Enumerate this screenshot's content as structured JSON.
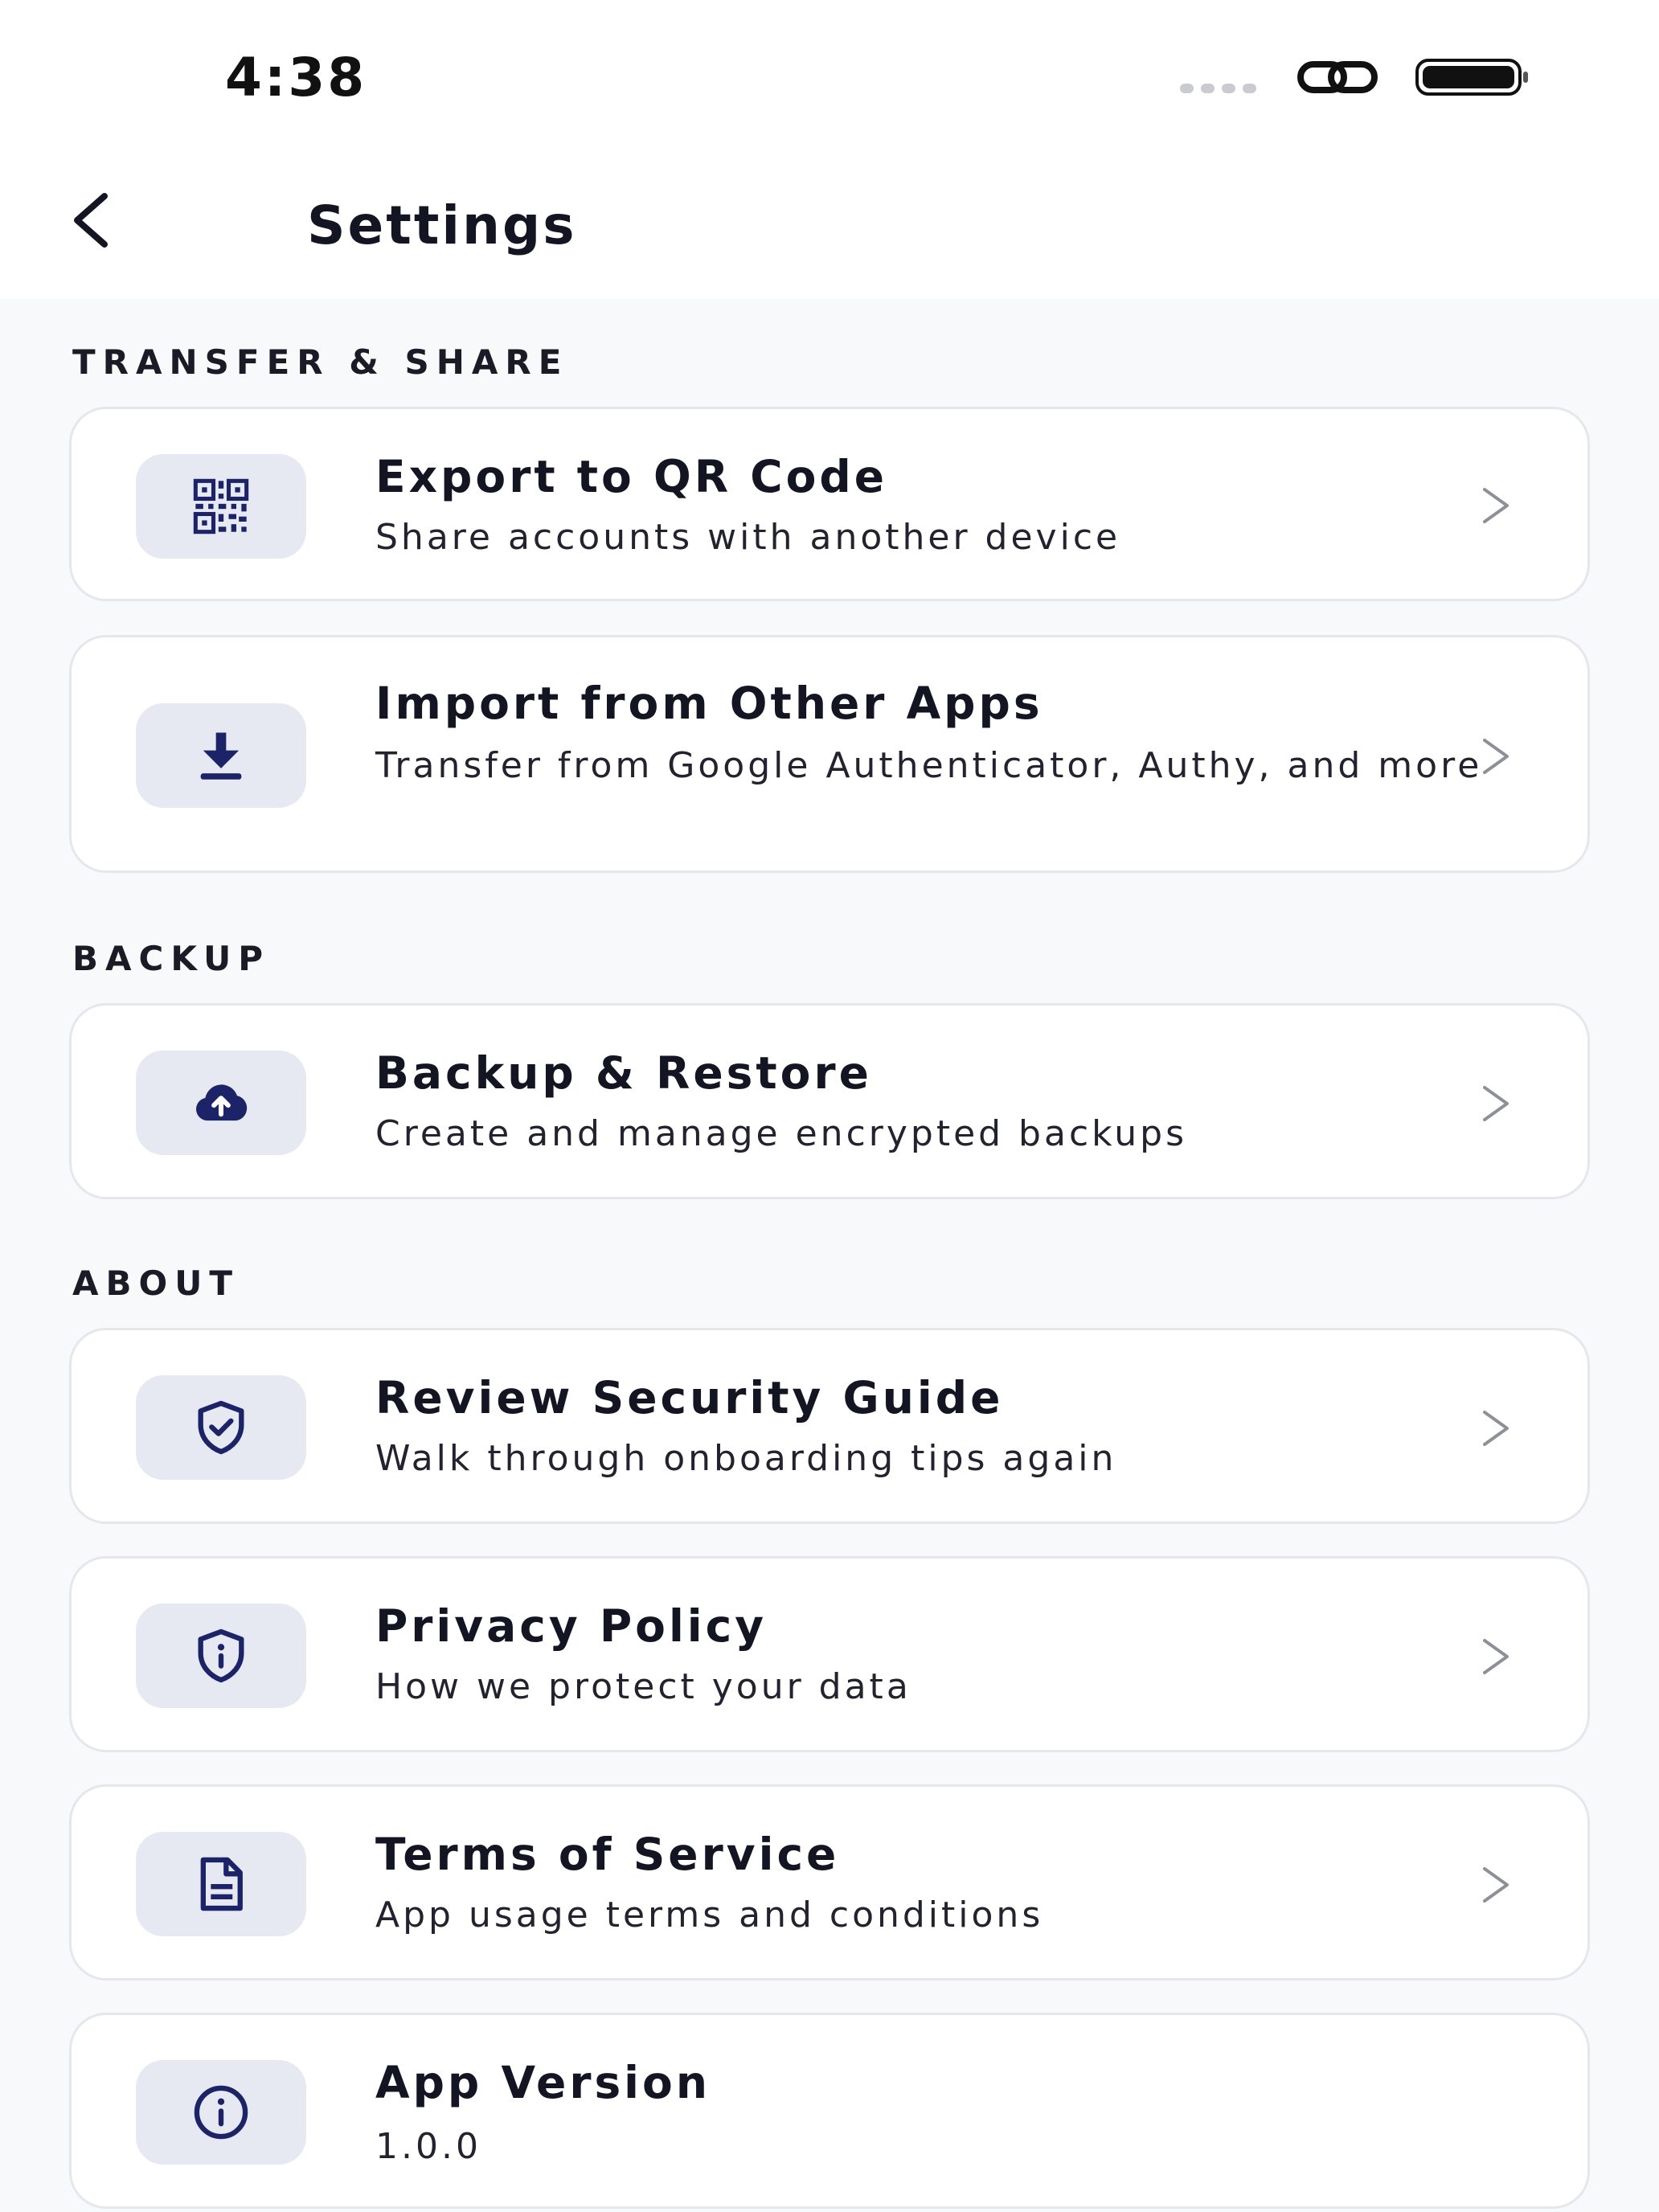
{
  "status_bar": {
    "time": "4:38",
    "icons": [
      "signal-dots-icon",
      "link-icon",
      "battery-icon"
    ]
  },
  "header": {
    "back_icon": "chevron-left-icon",
    "title": "Settings"
  },
  "sections": {
    "transfer": {
      "label": "TRANSFER & SHARE",
      "items": [
        {
          "icon": "qr-code-icon",
          "title": "Export to QR Code",
          "subtitle": "Share accounts with another device"
        },
        {
          "icon": "download-icon",
          "title": "Import from Other Apps",
          "subtitle": "Transfer from Google Authenticator, Authy, and more"
        }
      ]
    },
    "backup": {
      "label": "BACKUP",
      "items": [
        {
          "icon": "cloud-upload-icon",
          "title": "Backup & Restore",
          "subtitle": "Create and manage encrypted backups"
        }
      ]
    },
    "about": {
      "label": "ABOUT",
      "items": [
        {
          "icon": "shield-check-icon",
          "title": "Review Security Guide",
          "subtitle": "Walk through onboarding tips again"
        },
        {
          "icon": "shield-info-icon",
          "title": "Privacy Policy",
          "subtitle": "How we protect your data"
        },
        {
          "icon": "document-icon",
          "title": "Terms of Service",
          "subtitle": "App usage terms and conditions"
        },
        {
          "icon": "info-circle-icon",
          "title": "App Version",
          "subtitle": "1.0.0"
        }
      ]
    }
  },
  "colors": {
    "accent": "#1c2366",
    "icon_tile": "#e6e8f2",
    "page_background": "#f8f9fb",
    "card_border": "#e6e7ec",
    "chevron": "#8e9098"
  }
}
